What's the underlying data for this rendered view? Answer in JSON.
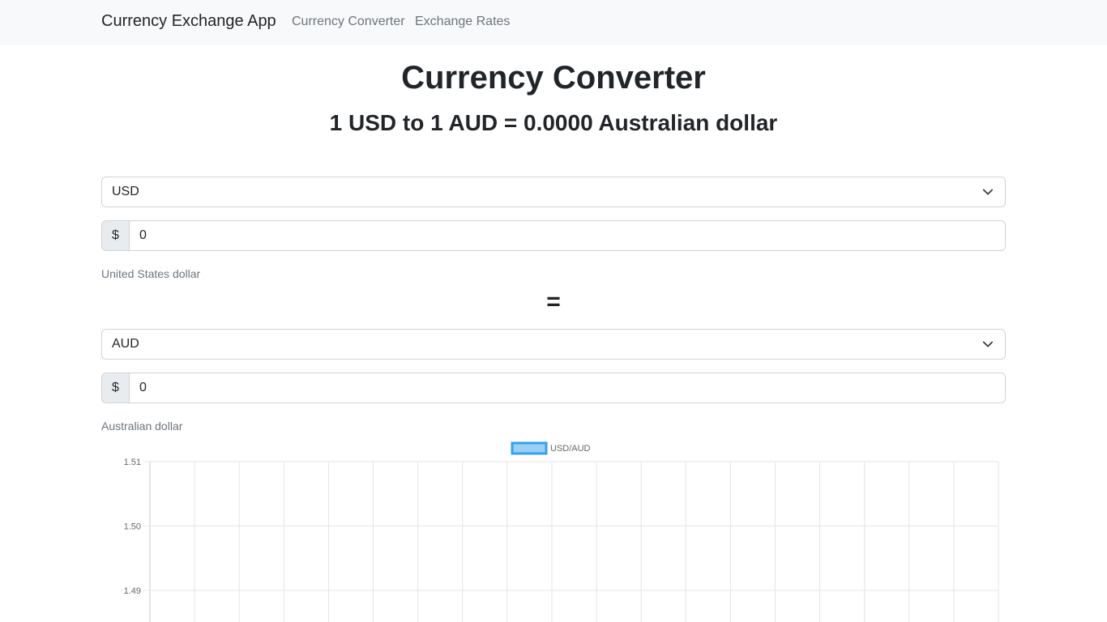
{
  "navbar": {
    "brand": "Currency Exchange App",
    "links": [
      {
        "label": "Currency Converter"
      },
      {
        "label": "Exchange Rates"
      }
    ]
  },
  "main": {
    "title": "Currency Converter",
    "rate_line": "1 USD to 1 AUD = 0.0000 Australian dollar",
    "from": {
      "currency": "USD",
      "symbol": "$",
      "amount": "0",
      "currency_name": "United States dollar"
    },
    "equals": "=",
    "to": {
      "currency": "AUD",
      "symbol": "$",
      "amount": "0",
      "currency_name": "Australian dollar"
    }
  },
  "icons": {
    "select_chevron": "chevron-down-icon"
  },
  "chart_data": {
    "type": "line",
    "series": [
      {
        "name": "USD/AUD",
        "values": []
      }
    ],
    "x": [],
    "ylim": [
      1.485,
      1.51
    ],
    "y_ticks": [
      "1.51",
      "1.50",
      "1.49"
    ],
    "x_gridlines": 20,
    "grid": true,
    "legend_position": "top",
    "colors": {
      "series_fill": "#9ad0f5",
      "series_border": "#36a2eb",
      "grid": "#e5e5e5",
      "axis": "#c8c8c8"
    }
  }
}
